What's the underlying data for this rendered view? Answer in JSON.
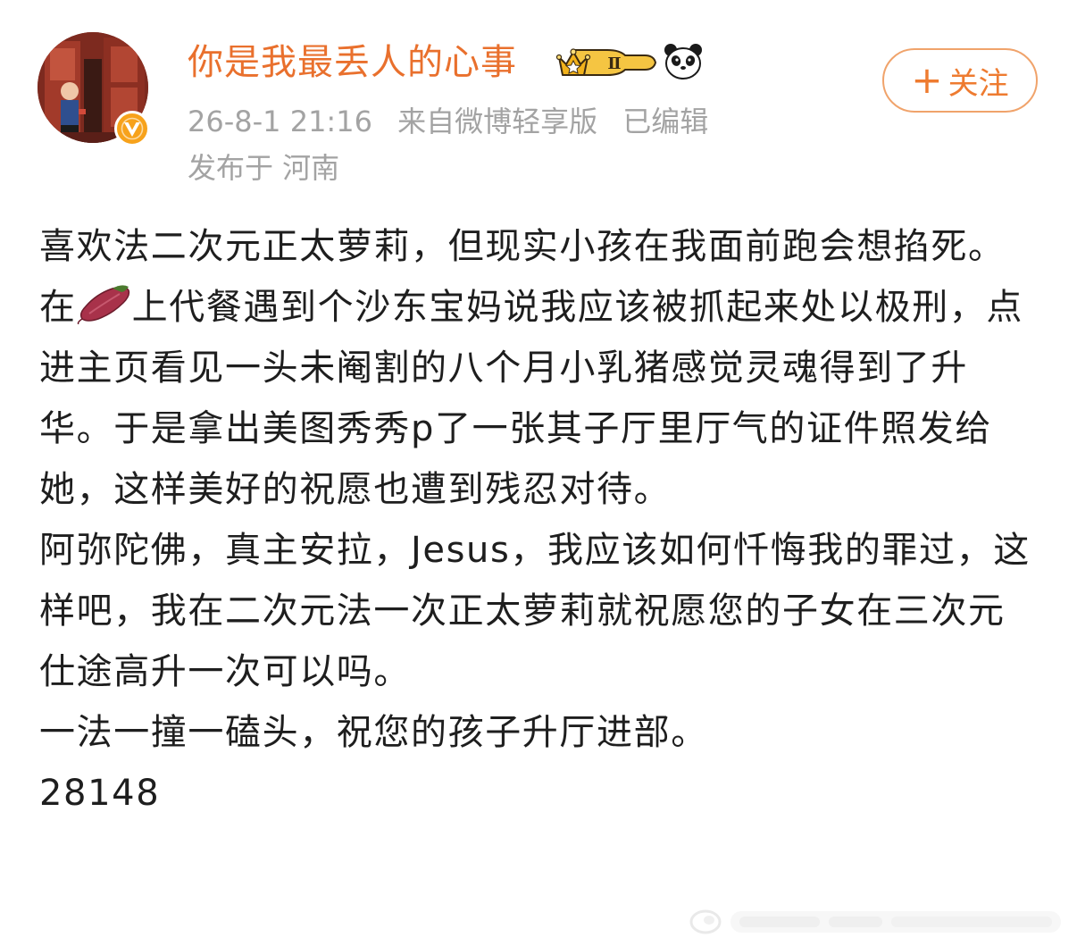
{
  "header": {
    "username": "你是我最丢人的心事",
    "level_badge": "Ⅱ",
    "timestamp": "26-8-1 21:16",
    "source": "来自微博轻享版",
    "edited": "已编辑",
    "location": "发布于 河南",
    "follow_label": "关注",
    "follow_plus": "+"
  },
  "post": {
    "line1": "喜欢法二次元正太萝莉，但现实小孩在我面前跑会想掐死。在",
    "line1_after_icon": "上代餐遇到个沙东宝妈说我应该被抓起来处以极刑，点进主页看见一头未阉割的八个月小乳猪感觉灵魂得到了升华。于是拿出美图秀秀p了一张其子厅里厅气的证件照发给她，这样美好的祝愿也遭到残忍对待。",
    "para2": "阿弥陀佛，真主安拉，Jesus，我应该如何忏悔我的罪过，这样吧，我在二次元法一次正太萝莉就祝愿您的子女在三次元仕途高升一次可以吗。",
    "para3": "一法一撞一磕头，祝您的孩子升厅进部。",
    "para4": "28148"
  },
  "icons": {
    "avatar": "avatar-image",
    "verify": "verified-v-icon",
    "crown": "crown-level-badge-icon",
    "panda": "panda-emoji-icon",
    "sweet_potato": "sweet-potato-emoji-icon",
    "watermark": "watermark-logo"
  },
  "colors": {
    "username": "#e9702d",
    "meta": "#a3a3a3",
    "follow_border": "#f0a36b",
    "follow_text": "#ee7b30",
    "body_text": "#1e1e1e",
    "verify_badge": "#f7a21b"
  }
}
